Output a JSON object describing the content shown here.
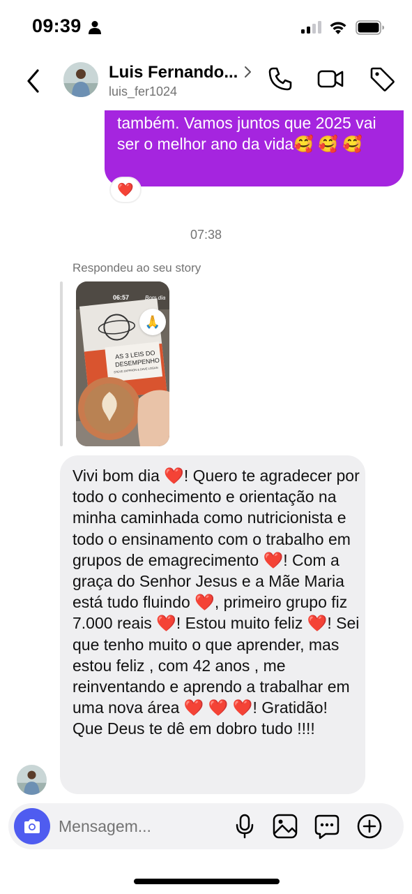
{
  "status_bar": {
    "time": "09:39"
  },
  "header": {
    "contact_name": "Luis Fernando...",
    "contact_handle": "luis_fer1024"
  },
  "chat": {
    "sent_message": "também. Vamos juntos que 2025 vai ser o melhor ano da vida🥰 🥰 🥰",
    "sent_reaction": "❤️",
    "timestamp": "07:38",
    "reply_caption": "Respondeu ao seu story",
    "story": {
      "time": "06:57",
      "greeting": "Bom dia",
      "book_title_line1": "AS 3 LEIS DO",
      "book_title_line2": "DESEMPENHO",
      "book_authors": "STEVE ZAFFRON & DAVE LOGAN",
      "reaction": "🙏"
    },
    "received_message": "Vivi bom dia ❤️! Quero te agradecer por todo o conhecimento e orientação na minha caminhada como nutricionista e todo o ensinamento com o trabalho em grupos de emagrecimento ❤️! Com a graça do Senhor Jesus e a Mãe Maria está tudo fluindo ❤️, primeiro grupo fiz 7.000 reais ❤️! Estou muito feliz ❤️! Sei que tenho muito o que aprender, mas estou feliz , com 42 anos , me reinventando e aprendo a trabalhar em uma nova área ❤️ ❤️ ❤️! Gratidão! Que Deus te dê em dobro tudo !!!!"
  },
  "composer": {
    "placeholder": "Mensagem..."
  },
  "colors": {
    "sent_bubble": "#a525df",
    "received_bubble": "#efeff1",
    "camera_button": "#4f5cf0",
    "muted_text": "#737373"
  },
  "icons": [
    "person-icon",
    "signal-icon",
    "wifi-icon",
    "battery-icon",
    "back-arrow-icon",
    "chevron-right-icon",
    "phone-icon",
    "video-icon",
    "tag-icon",
    "camera-icon",
    "microphone-icon",
    "gallery-icon",
    "sticker-icon",
    "plus-icon"
  ]
}
